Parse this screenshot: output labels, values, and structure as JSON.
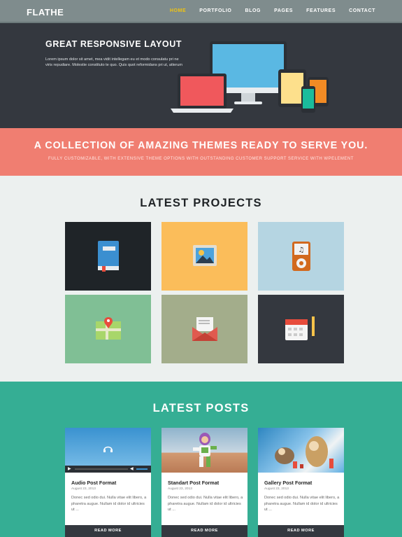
{
  "nav": {
    "logo": "FLATHE",
    "items": [
      {
        "label": "HOME",
        "active": true
      },
      {
        "label": "PORTFOLIO",
        "active": false
      },
      {
        "label": "BLOG",
        "active": false
      },
      {
        "label": "PAGES",
        "active": false
      },
      {
        "label": "FEATURES",
        "active": false
      },
      {
        "label": "CONTACT",
        "active": false
      }
    ]
  },
  "hero": {
    "title": "GREAT RESPONSIVE LAYOUT",
    "text": "Lorem ipsum dolor sit amet, mea vidit intellegam eu et modo consulatu pri ne viris repudiare. Molestie constituto te quo. Quis quot reformidans pri ut, atterum"
  },
  "banner": {
    "title": "A COLLECTION OF AMAZING THEMES READY TO SERVE YOU.",
    "subtitle": "FULLY CUSTOMIZABLE, WITH EXTENSIVE THEME OPTIONS WITH OUTSTANDING CUSTOMER SUPPORT SERVICE WITH WPELEMENT"
  },
  "projects": {
    "title": "LATEST PROJECTS",
    "tiles": [
      {
        "icon": "book-icon",
        "bg": "#1f2428"
      },
      {
        "icon": "picture-icon",
        "bg": "#fbbd5a"
      },
      {
        "icon": "music-player-icon",
        "bg": "#b5d5e2"
      },
      {
        "icon": "map-icon",
        "bg": "#80bf95"
      },
      {
        "icon": "mail-icon",
        "bg": "#a3ad8b"
      },
      {
        "icon": "calendar-icon",
        "bg": "#34383f"
      }
    ]
  },
  "posts": {
    "title": "LATEST POSTS",
    "items": [
      {
        "title": "Audio Post Format",
        "date": "August 23, 2013",
        "text": "Donec sed odio dui. Nulla vitae elit libero, a pharetra augue. Nullam id dolor id ultricies ut ...",
        "button": "READ MORE"
      },
      {
        "title": "Standart Post Format",
        "date": "August 23, 2013",
        "text": "Donec sed odio dui. Nulla vitae elit libero, a pharetra augue. Nullam id dolor id ultricies ut ...",
        "button": "READ MORE"
      },
      {
        "title": "Gallery Post Format",
        "date": "August 23, 2013",
        "text": "Donec sed odio dui. Nulla vitae elit libero, a pharetra augue. Nullam id dolor id ultricies ut ...",
        "button": "READ MORE"
      }
    ]
  }
}
